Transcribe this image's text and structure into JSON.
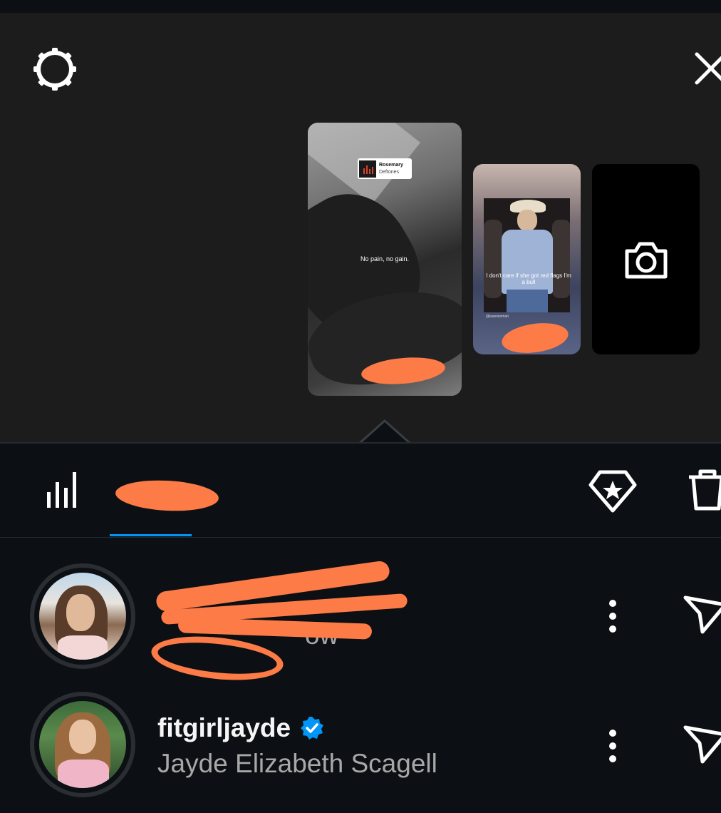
{
  "viewer": {
    "settings_icon": "gear-icon",
    "close_icon": "close-icon"
  },
  "stories": [
    {
      "music_title": "Rosemary",
      "music_artist": "Deftones",
      "caption": "No pain, no gain."
    },
    {
      "caption": "I don't care if she got red flags I'm a bull",
      "handle": "@laserwoman"
    },
    {
      "camera_icon": "camera-icon"
    }
  ],
  "tabs": {
    "insights_icon": "bar-chart-icon",
    "viewers_label_redacted": true,
    "highlight_icon": "highlight-heart-icon",
    "delete_icon": "trash-icon"
  },
  "viewers": [
    {
      "username_redacted": true,
      "subtitle_partial": "ow"
    },
    {
      "username": "fitgirljayde",
      "verified": true,
      "full_name": "Jayde Elizabeth Scagell"
    }
  ],
  "colors": {
    "accent": "#0095f6",
    "redaction": "#fd7b46",
    "background": "#0c1014",
    "viewer_bg": "#1c1c1c"
  }
}
